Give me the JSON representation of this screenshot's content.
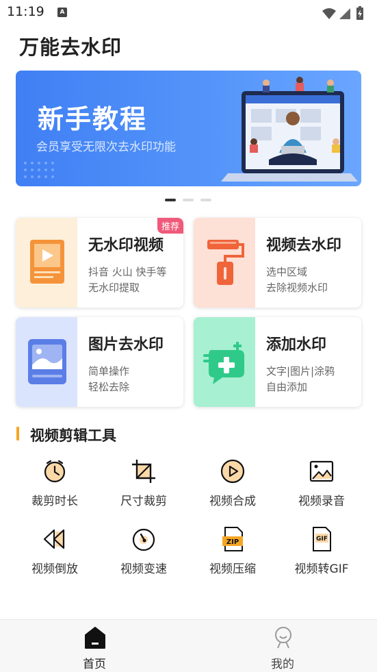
{
  "status_bar": {
    "time": "11:19",
    "notification_letter": "A"
  },
  "app_title": "万能去水印",
  "banner": {
    "title": "新手教程",
    "subtitle": "会员享受无限次去水印功能"
  },
  "carousel": {
    "count": 3,
    "active_index": 0
  },
  "feature_cards": [
    {
      "title": "无水印视频",
      "line1": "抖音 火山 快手等",
      "line2": "无水印提取",
      "badge": "推荐",
      "icon": "video-play-icon",
      "color": "#f5933a",
      "bg": "#fdefd9"
    },
    {
      "title": "视频去水印",
      "line1": "选中区域",
      "line2": "去除视频水印",
      "icon": "paint-roller-icon",
      "color": "#f0643a",
      "bg": "#fde0d6"
    },
    {
      "title": "图片去水印",
      "line1": "简单操作",
      "line2": "轻松去除",
      "icon": "image-icon",
      "color": "#5b7de6",
      "bg": "#dbe4fd"
    },
    {
      "title": "添加水印",
      "line1": "文字|图片|涂鸦",
      "line2": "自由添加",
      "icon": "add-watermark-icon",
      "color": "#2fca8a",
      "bg": "#a7f0d2"
    }
  ],
  "section": {
    "title": "视频剪辑工具",
    "accent": "#f5a623"
  },
  "tools": [
    {
      "label": "裁剪时长",
      "icon": "clock-icon"
    },
    {
      "label": "尺寸裁剪",
      "icon": "crop-icon"
    },
    {
      "label": "视频合成",
      "icon": "play-circle-icon"
    },
    {
      "label": "视频录音",
      "icon": "image-frame-icon"
    },
    {
      "label": "视频倒放",
      "icon": "rewind-icon"
    },
    {
      "label": "视频变速",
      "icon": "speed-icon"
    },
    {
      "label": "视频压缩",
      "icon": "zip-file-icon",
      "badge": "ZIP"
    },
    {
      "label": "视频转GIF",
      "icon": "gif-file-icon",
      "badge": "GIF"
    }
  ],
  "tabs": [
    {
      "label": "首页",
      "icon": "home-icon",
      "active": true
    },
    {
      "label": "我的",
      "icon": "profile-icon",
      "active": false
    }
  ]
}
